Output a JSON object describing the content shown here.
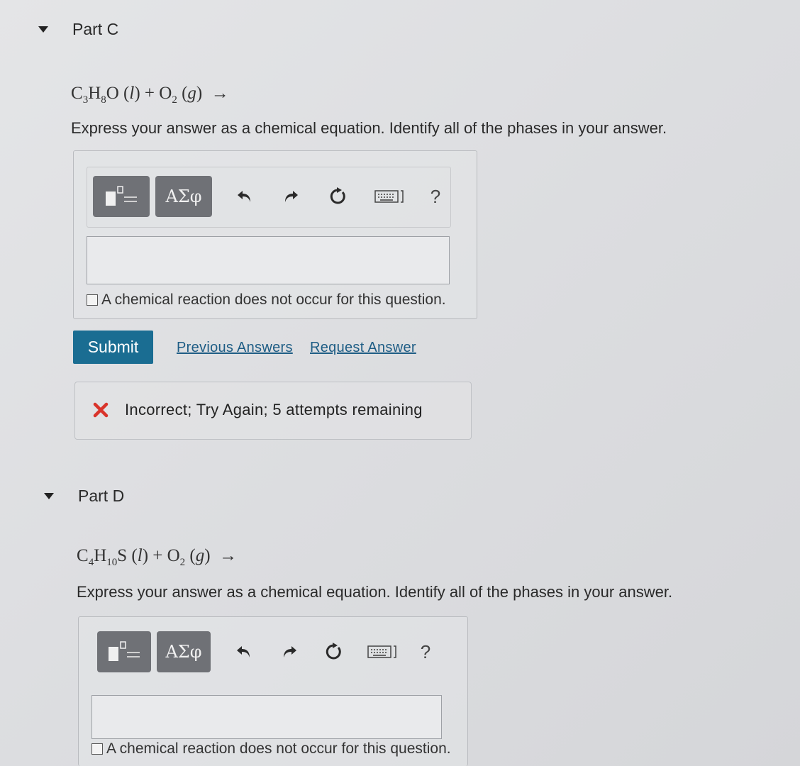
{
  "parts": [
    {
      "header": "Part C",
      "instructions": "Express your answer as a chemical equation. Identify all of the phases in your answer.",
      "toolbar": {
        "symbols_label": "ΑΣφ",
        "help_label": "?"
      },
      "checkbox_label": "A chemical reaction does not occur for this question.",
      "submit_label": "Submit",
      "previous_answers_label": "Previous Answers",
      "request_answer_label": "Request Answer",
      "feedback": "Incorrect; Try Again; 5 attempts remaining"
    },
    {
      "header": "Part D",
      "instructions": "Express your answer as a chemical equation. Identify all of the phases in your answer.",
      "toolbar": {
        "symbols_label": "ΑΣφ",
        "help_label": "?"
      },
      "checkbox_label": "A chemical reaction does not occur for this question."
    }
  ],
  "colors": {
    "submit": "#1a6d92",
    "link": "#1e5d85",
    "error": "#d9342b",
    "toolbar_button": "#6f7176"
  }
}
